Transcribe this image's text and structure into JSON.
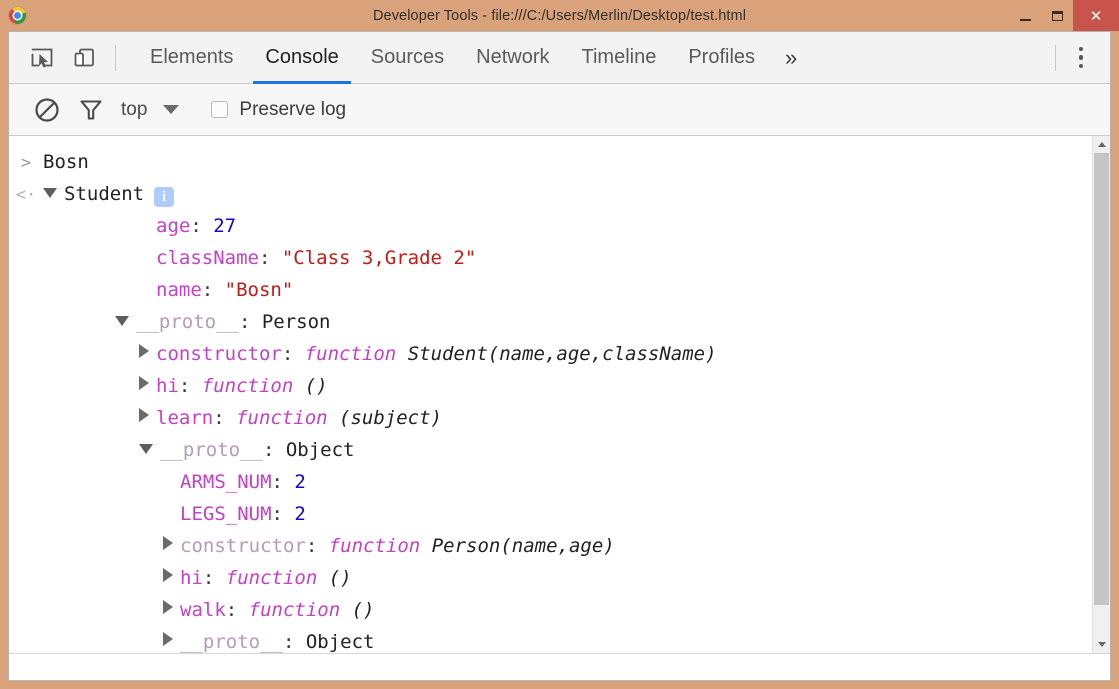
{
  "window": {
    "title": "Developer Tools - file:///C:/Users/Merlin/Desktop/test.html",
    "logo_icon": "chrome-logo",
    "minimize_label": "",
    "maximize_label": "",
    "close_label": "✕",
    "frame_color": "#d9a27a",
    "close_color": "#c9544c"
  },
  "toolbar": {
    "inspect_icon": "inspect-element-icon",
    "device_icon": "device-toolbar-icon",
    "more_menu_icon": "kebab-menu-icon",
    "overflow_tabs_label": "»",
    "accent_color": "#1a73e8"
  },
  "tabs": [
    {
      "label": "Elements",
      "active": false
    },
    {
      "label": "Console",
      "active": true
    },
    {
      "label": "Sources",
      "active": false
    },
    {
      "label": "Network",
      "active": false
    },
    {
      "label": "Timeline",
      "active": false
    },
    {
      "label": "Profiles",
      "active": false
    }
  ],
  "filterbar": {
    "clear_icon": "clear-console-icon",
    "filter_icon": "filter-funnel-icon",
    "context_value": "top",
    "context_caret_icon": "chevron-down-icon",
    "preserve_log_label": "Preserve log",
    "preserve_log_checked": false
  },
  "console": {
    "input_prompt_glyph": ">",
    "output_prompt_glyph": "<·",
    "input_text": "Bosn",
    "object_name": "Student",
    "info_badge": "i",
    "rows": [
      {
        "key": "age",
        "sep": ": ",
        "value": "27",
        "value_class": "num",
        "key_class": "prop",
        "tri": "none",
        "indent": 4
      },
      {
        "key": "className",
        "sep": ": ",
        "value": "\"Class 3,Grade 2\"",
        "value_class": "str",
        "key_class": "prop",
        "tri": "none",
        "indent": 4
      },
      {
        "key": "name",
        "sep": ": ",
        "value": "\"Bosn\"",
        "value_class": "str",
        "key_class": "prop",
        "tri": "none",
        "indent": 4
      },
      {
        "key": "__proto__",
        "sep": ": ",
        "value": "Person",
        "value_class": "plain",
        "key_class": "prop-dim",
        "tri": "open",
        "indent": 3
      },
      {
        "key": "constructor",
        "sep": ": ",
        "fn": "function",
        "fn_name": " Student(name,age,className)",
        "key_class": "prop",
        "tri": "closed",
        "indent": 4
      },
      {
        "key": "hi",
        "sep": ": ",
        "fn": "function",
        "fn_name": " ()",
        "key_class": "prop",
        "tri": "closed",
        "indent": 4
      },
      {
        "key": "learn",
        "sep": ": ",
        "fn": "function",
        "fn_name": " (subject)",
        "key_class": "prop",
        "tri": "closed",
        "indent": 4
      },
      {
        "key": "__proto__",
        "sep": ": ",
        "value": "Object",
        "value_class": "plain",
        "key_class": "prop-dim",
        "tri": "open",
        "indent": 4
      },
      {
        "key": "ARMS_NUM",
        "sep": ": ",
        "value": "2",
        "value_class": "num",
        "key_class": "prop",
        "tri": "none",
        "indent": 5
      },
      {
        "key": "LEGS_NUM",
        "sep": ": ",
        "value": "2",
        "value_class": "num",
        "key_class": "prop",
        "tri": "none",
        "indent": 5
      },
      {
        "key": "constructor",
        "sep": ": ",
        "fn": "function",
        "fn_name": " Person(name,age)",
        "key_class": "prop-dim",
        "tri": "closed",
        "indent": 5
      },
      {
        "key": "hi",
        "sep": ": ",
        "fn": "function",
        "fn_name": " ()",
        "key_class": "prop",
        "tri": "closed",
        "indent": 5
      },
      {
        "key": "walk",
        "sep": ": ",
        "fn": "function",
        "fn_name": " ()",
        "key_class": "prop",
        "tri": "closed",
        "indent": 5
      },
      {
        "key": "__proto__",
        "sep": ": ",
        "value": "Object",
        "value_class": "plain",
        "key_class": "prop-dim",
        "tri": "closed",
        "indent": 5
      }
    ]
  },
  "scrollbar": {
    "up_icon": "scroll-up-arrow-icon",
    "down_icon": "scroll-down-arrow-icon"
  },
  "colors": {
    "property": "#c341c3",
    "property_dim": "#b79ab7",
    "string": "#c41a16",
    "number": "#1c00cf",
    "plain": "#222222",
    "badge": "#aecbfa"
  }
}
